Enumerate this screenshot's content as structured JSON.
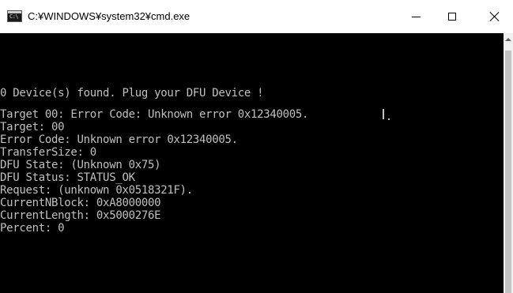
{
  "window": {
    "title": "C:¥WINDOWS¥system32¥cmd.exe",
    "icon": "cmd-console-icon",
    "icon_glyph": "C:\\",
    "controls": {
      "minimize": "minimize-icon",
      "maximize": "maximize-icon",
      "close": "close-icon"
    }
  },
  "console": {
    "background": "#000000",
    "foreground": "#c0c0c0",
    "lines": [
      "0 Device(s) found. Plug your DFU Device !",
      "Target 00: Error Code: Unknown error 0x12340005.",
      "Target: 00",
      "Error Code: Unknown error 0x12340005.",
      "TransferSize: 0",
      "DFU State: (Unknown 0x75)",
      "DFU Status: STATUS_OK",
      "Request: (unknown 0x0518321F).",
      "CurrentNBlock: 0xA8000000",
      "CurrentLength: 0x5000276E",
      "Percent: 0"
    ]
  }
}
